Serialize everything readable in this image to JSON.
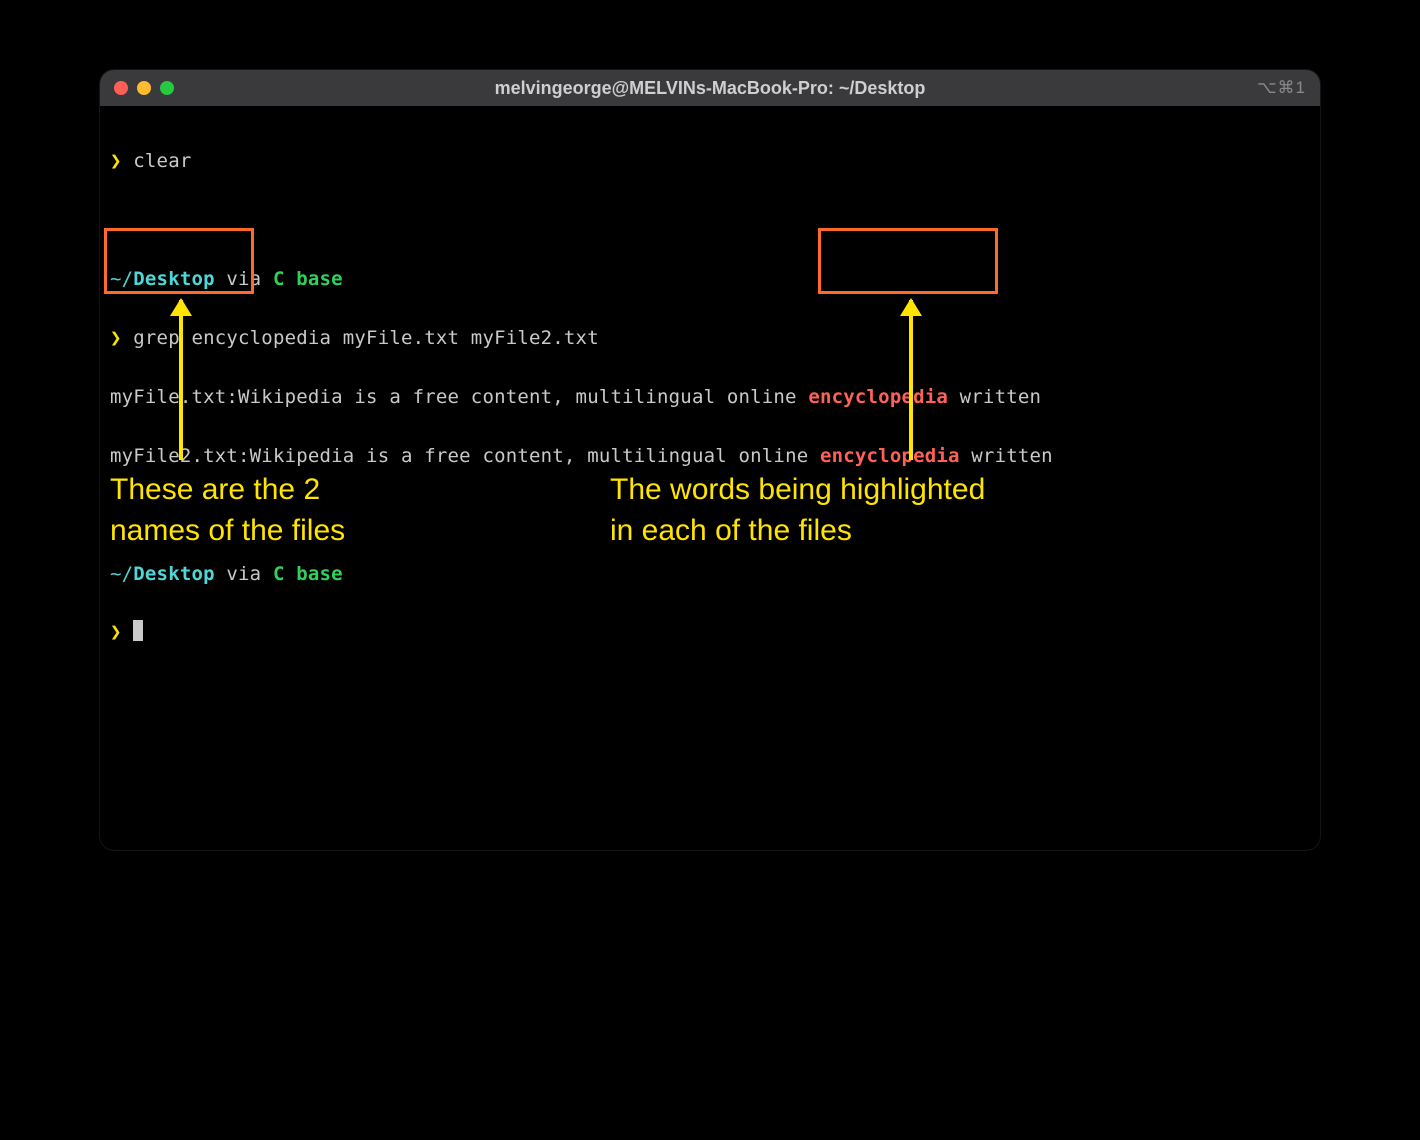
{
  "window": {
    "title": "melvingeorge@MELVINs-MacBook-Pro: ~/Desktop",
    "right_indicator": "⌥⌘1"
  },
  "lines": {
    "l1_prompt": "❯",
    "l1_cmd": " clear",
    "l2_path_prefix": "~/",
    "l2_path_bold": "Desktop",
    "l2_via": " via ",
    "l2_env": "C base",
    "l3_prompt": "❯",
    "l3_cmd": " grep encyclopedia myFile.txt myFile2.txt",
    "l4_file": "myFile.txt:",
    "l4_before": "Wikipedia is a free content, multilingual online ",
    "l4_match": "encyclopedia",
    "l4_after": " written",
    "l5_file": "myFile2.txt:",
    "l5_before": "Wikipedia is a free content, multilingual online ",
    "l5_match": "encyclopedia",
    "l5_after": " written",
    "l6_path_prefix": "~/",
    "l6_path_bold": "Desktop",
    "l6_via": " via ",
    "l6_env": "C base",
    "l7_prompt": "❯"
  },
  "annotations": {
    "left_text": "These are the 2\nnames of the files",
    "right_text": "The words being highlighted\nin each of the files"
  },
  "colors": {
    "accent_orange": "#ff6a2b",
    "accent_yellow": "#ffe400",
    "match_red": "#ff6159",
    "cyan": "#4fd6d6",
    "green": "#30d158"
  }
}
